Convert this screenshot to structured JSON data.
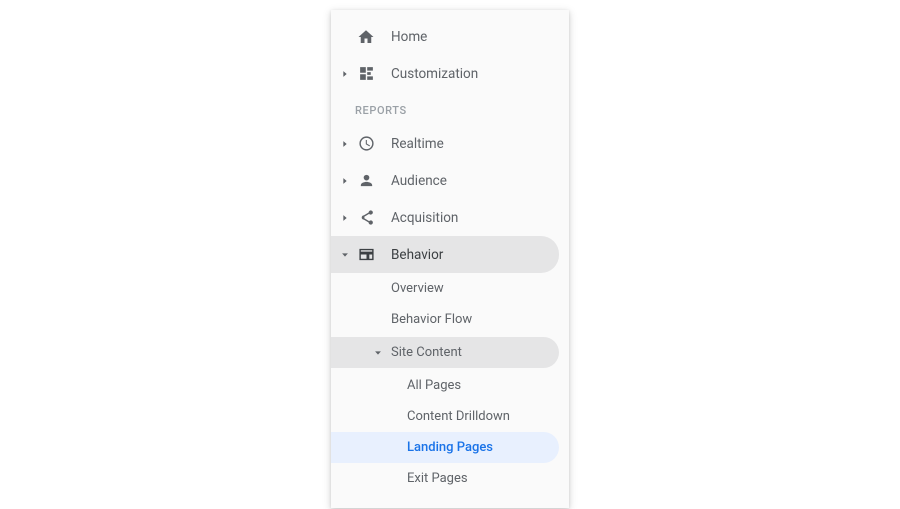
{
  "nav": {
    "home": "Home",
    "customization": "Customization"
  },
  "sectionLabel": "REPORTS",
  "reports": {
    "realtime": "Realtime",
    "audience": "Audience",
    "acquisition": "Acquisition",
    "behavior": "Behavior"
  },
  "behavior": {
    "overview": "Overview",
    "flow": "Behavior Flow",
    "siteContent": "Site Content",
    "pages": {
      "all": "All Pages",
      "drilldown": "Content Drilldown",
      "landing": "Landing Pages",
      "exit": "Exit Pages"
    }
  }
}
